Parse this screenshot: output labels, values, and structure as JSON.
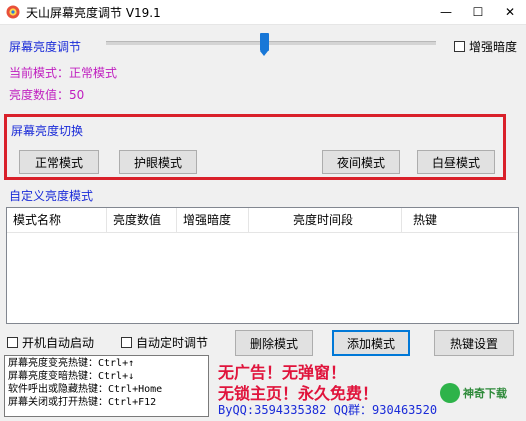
{
  "window": {
    "title": "天山屏幕亮度调节  V19.1",
    "controls": {
      "minimize": "—",
      "maximize": "☐",
      "close": "✕"
    }
  },
  "brightness": {
    "label": "屏幕亮度调节",
    "slider_fraction": 0.48,
    "enhance_label": "增强暗度",
    "enhance_checked": false,
    "current_mode_text": "当前模式：正常模式",
    "current_value_text": "亮度数值：50"
  },
  "switch_section": {
    "title": "屏幕亮度切换",
    "buttons": [
      "正常模式",
      "护眼模式",
      "夜间模式",
      "白昼模式"
    ]
  },
  "custom_section": {
    "title": "自定义亮度模式",
    "columns": [
      "模式名称",
      "亮度数值",
      "增强暗度",
      "亮度时间段",
      "热键"
    ],
    "rows": []
  },
  "options": {
    "autostart_label": "开机自动启动",
    "autostart_checked": false,
    "auto_timer_label": "自动定时调节",
    "auto_timer_checked": false
  },
  "actions": {
    "delete_label": "删除模式",
    "add_label": "添加模式",
    "hotkey_label": "热键设置"
  },
  "hotkey_info": [
    "屏幕亮度变亮热键：Ctrl+↑",
    "屏幕亮度变暗热键：Ctrl+↓",
    "软件呼出或隐藏热键：Ctrl+Home",
    "屏幕关闭或打开热键：Ctrl+F12"
  ],
  "promo": {
    "line1": "无广告！无弹窗！",
    "line2": "无锁主页！永久免费！",
    "contact": "ByQQ:3594335382 QQ群：930463520"
  },
  "watermark": {
    "text": "神奇下载"
  },
  "colors": {
    "accent_blue": "#1a2bd8",
    "label_purple": "#c020c0",
    "highlight_red": "#d9202a",
    "slider_blue": "#1877d7",
    "promo_red": "#e0143c"
  }
}
